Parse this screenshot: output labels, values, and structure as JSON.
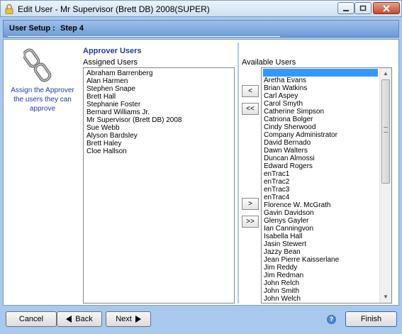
{
  "window": {
    "title": "Edit User - Mr Supervisor (Brett DB) 2008(SUPER)"
  },
  "header": {
    "title": "User Setup :",
    "step": "Step 4"
  },
  "info": {
    "text": "Assign the Approver the users they can approve"
  },
  "approver": {
    "heading": "Approver Users",
    "assigned_label": "Assigned Users",
    "assigned_users": [
      "Abraham Barrenberg",
      "Alan Harmen",
      "Stephen Snape",
      "Brett Hall",
      "Stephanie Foster",
      "Bernard Williams Jr.",
      "Mr Supervisor (Brett DB) 2008",
      "Sue Webb",
      "Alyson Bardsley",
      "Brett Haley",
      "Cloe Hallson"
    ]
  },
  "available": {
    "label": "Available Users",
    "users": [
      "Aretha Evans",
      "Brian Watkins",
      "Carl Aspey",
      "Carol Smyth",
      "Catherine Simpson",
      "Catriona Bolger",
      "Cindy Sherwood",
      "Company Administrator",
      "David Bernado",
      "Dawn Walters",
      "Duncan Almossi",
      "Edward Rogers",
      "enTrac1",
      "enTrac2",
      "enTrac3",
      "enTrac4",
      "Florence W. McGrath",
      "Gavin Davidson",
      "Glenys Gayler",
      "Ian Canningvon",
      "Isabella Hall",
      "Jasin Stewert",
      "Jazzy Bean",
      "Jean Pierre Kaisserlane",
      "Jim Reddy",
      "Jim Redman",
      "John Relch",
      "John Smith",
      "John Welch"
    ]
  },
  "transfer": {
    "move_left": "<",
    "move_all_left": "<<",
    "move_right": ">",
    "move_all_right": ">>"
  },
  "footer": {
    "cancel_label": "Cancel",
    "back_label": "Back",
    "next_label": "Next",
    "finish_label": "Finish",
    "help": "?"
  },
  "colors": {
    "frame_blue": "#a8c8ee",
    "header_blue": "#6d9ad6",
    "heading_text": "#1f3ea0",
    "selection": "#3399ff"
  }
}
